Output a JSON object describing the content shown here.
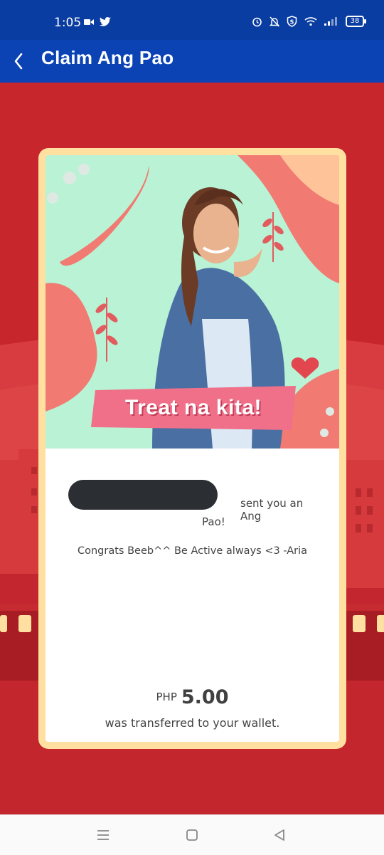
{
  "status_bar": {
    "time": "1:05",
    "left_icons": [
      "video-camera-icon",
      "twitter-icon"
    ],
    "right_icons": [
      "alarm-icon",
      "mute-bell-icon",
      "s-app-icon",
      "wifi-icon",
      "signal-icon"
    ],
    "battery": "38"
  },
  "app_bar": {
    "back_icon": "back-arrow-icon",
    "title": "Claim Ang Pao"
  },
  "card": {
    "banner_text": "Treat na kita!",
    "sender_suffix_line1": "sent you an Ang",
    "sender_suffix_line2": "Pao!",
    "message": "Congrats Beeb^^ Be Active always <3 -Aria",
    "currency": "PHP",
    "amount": "5.00",
    "transfer_note": "was transferred to your wallet."
  },
  "bottom_nav": {
    "items": [
      "menu-icon",
      "home-square-icon",
      "back-triangle-icon"
    ]
  },
  "colors": {
    "status_bar": "#0a3da1",
    "app_bar": "#0b43b4",
    "background_red": "#c6262c",
    "card_border": "#ffe0a0",
    "art_mint": "#b9f2d4",
    "banner_pink": "#f0708a"
  }
}
